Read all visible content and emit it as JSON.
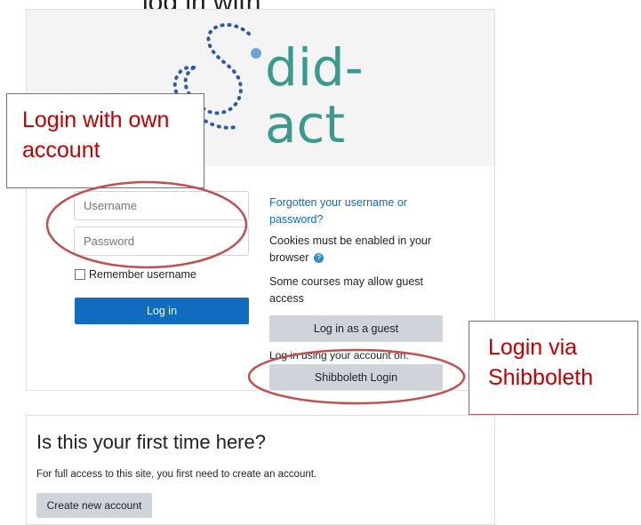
{
  "page": {
    "cut_title": "log in with",
    "logo": {
      "line1": "did-",
      "line2": "act",
      "colors": {
        "dots": "#2a5aa8",
        "teal": "#3a9a8e",
        "text": "#3a9a8e"
      }
    }
  },
  "login": {
    "username_placeholder": "Username",
    "password_placeholder": "Password",
    "remember_label": "Remember username",
    "login_button": "Log in",
    "forgot_link": "Forgotten your username or password?",
    "cookies_text": "Cookies must be enabled in your browser",
    "help_icon": "?",
    "guest_note": "Some courses may allow guest access",
    "guest_button": "Log in as a guest",
    "shibboleth_label": "Log in using your account on:",
    "shibboleth_button": "Shibboleth Login"
  },
  "first_time": {
    "heading": "Is this your first time here?",
    "text": "For full access to this site, you first need to create an account.",
    "create_button": "Create new account"
  },
  "annotations": {
    "own_account": "Login with own account",
    "shibboleth": "Login via Shibboleth",
    "color": "#c00000"
  }
}
